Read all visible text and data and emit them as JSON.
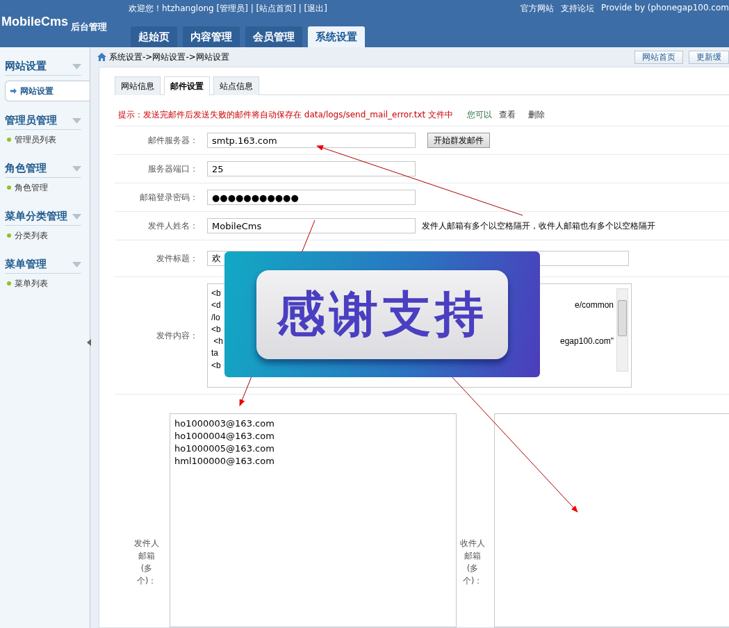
{
  "header": {
    "logo": "MobileCms",
    "subtitle": "后台管理",
    "welcome": "欢迎您！htzhanglong [管理员] | [站点首页] | [退出]",
    "links": [
      "官方网站",
      "支持论坛",
      "Provide by (phonegap100.com"
    ],
    "tabs": [
      {
        "label": "起始页",
        "selected": false
      },
      {
        "label": "内容管理",
        "selected": false
      },
      {
        "label": "会员管理",
        "selected": false
      },
      {
        "label": "系统设置",
        "selected": true
      }
    ]
  },
  "sidebar": {
    "groups": [
      {
        "title": "网站设置",
        "items": [
          {
            "label": "网站设置",
            "selected": true
          }
        ]
      },
      {
        "title": "管理员管理",
        "items": [
          {
            "label": "管理员列表",
            "selected": false
          }
        ]
      },
      {
        "title": "角色管理",
        "items": [
          {
            "label": "角色管理",
            "selected": false
          }
        ]
      },
      {
        "title": "菜单分类管理",
        "items": [
          {
            "label": "分类列表",
            "selected": false
          }
        ]
      },
      {
        "title": "菜单管理",
        "items": [
          {
            "label": "菜单列表",
            "selected": false
          }
        ]
      }
    ]
  },
  "breadcrumb": "系统设置->网站设置->网站设置",
  "toolbar_buttons": [
    "网站首页",
    "更新缓"
  ],
  "tabs": [
    {
      "label": "网站信息",
      "selected": false
    },
    {
      "label": "邮件设置",
      "selected": true
    },
    {
      "label": "站点信息",
      "selected": false
    }
  ],
  "notice": {
    "text": "提示：发送完邮件后发送失败的邮件将自动保存在 data/logs/send_mail_error.txt 文件中",
    "prompt": "您可以",
    "links": [
      "查看",
      "删除"
    ]
  },
  "fields": [
    {
      "label": "邮件服务器：",
      "value": "smtp.163.com",
      "button": "开始群发邮件"
    },
    {
      "label": "服务器端口：",
      "value": "25"
    },
    {
      "label": "邮箱登录密码：",
      "value": "●●●●●●●●●●●"
    },
    {
      "label": "发件人姓名：",
      "value": "MobileCms",
      "hint": "发件人邮箱有多个以空格隔开，收件人邮箱也有多个以空格隔开"
    },
    {
      "label": "发件标题：",
      "value": "欢"
    }
  ],
  "content": {
    "label": "发件内容：",
    "lines": [
      {
        "left": "<b"
      },
      {
        "left": "<d",
        "right": "e/common"
      },
      {
        "left": "/lo"
      },
      {
        "left": "<b"
      },
      {
        "left": " <h",
        "right": "egap100.com\""
      },
      {
        "left": "ta"
      },
      {
        "left": "<b"
      }
    ]
  },
  "senders": {
    "label": "发件人邮箱(多个)：",
    "emails": [
      "ho1000003@163.com",
      "ho1000004@163.com",
      "ho1000005@163.com",
      "hml100000@163.com"
    ]
  },
  "receivers": {
    "label": "收件人邮箱(多个)："
  },
  "overlay": {
    "text": "感谢支持"
  }
}
